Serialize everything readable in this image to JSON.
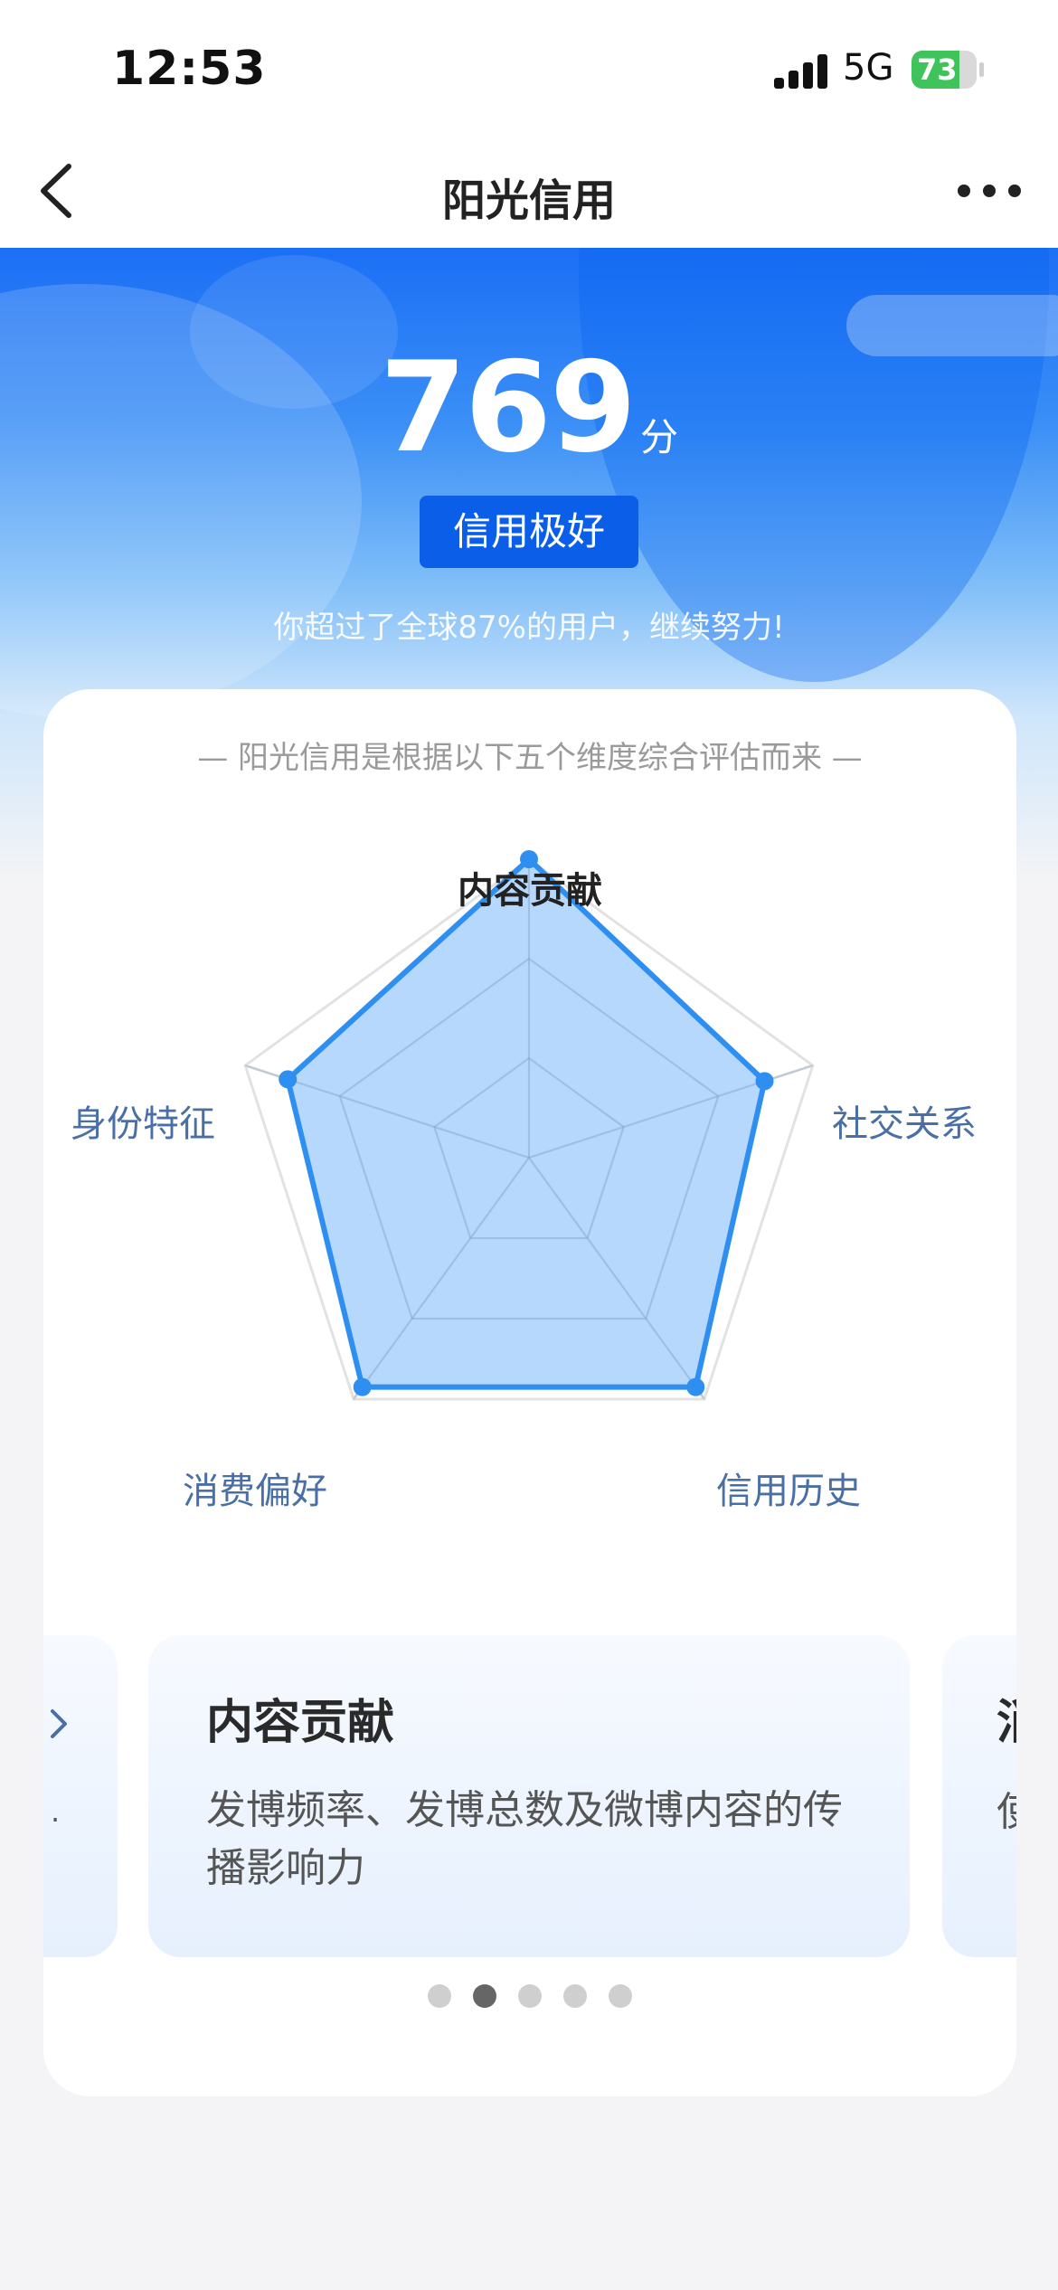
{
  "status_bar": {
    "time": "12:53",
    "network": "5G",
    "battery": "73",
    "battery_level_percent": 73,
    "battery_color": "#3ec45a"
  },
  "nav": {
    "title": "阳光信用",
    "back_icon": "chevron-left-icon",
    "more_icon": "more-horizontal-icon"
  },
  "hero": {
    "score": "769",
    "score_unit": "分",
    "rating": "信用极好",
    "percentile_text": "你超过了全球87%的用户，继续努力!"
  },
  "card": {
    "description": "— 阳光信用是根据以下五个维度综合评估而来 —",
    "radar": {
      "axes": [
        "内容贡献",
        "社交关系",
        "信用历史",
        "消费偏好",
        "身份特征"
      ],
      "active_axis": "内容贡献",
      "values": [
        1.0,
        0.83,
        0.95,
        0.95,
        0.85
      ],
      "max": 1.0,
      "fill_color": "#a9d1fb",
      "line_color": "#2f8ff0"
    },
    "carousel": {
      "prev_visible": ">",
      "prev_sub": ".",
      "active_index": 1,
      "slides": [
        {
          "title": "内容贡献",
          "desc": "发博频率、发博总数及微博内容的传播影响力"
        }
      ],
      "next_peek_title": "消",
      "next_peek_desc": "使",
      "dot_count": 5
    }
  },
  "colors": {
    "primary_blue": "#0a5ee8",
    "label_blue": "#4a6fa5",
    "page_bg": "#f4f4f6"
  }
}
